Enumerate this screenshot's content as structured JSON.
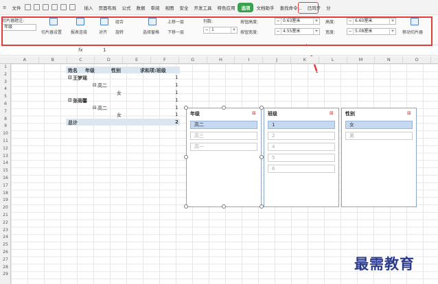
{
  "menubar": {
    "hamburger": "≡",
    "file": "文件",
    "tabs": [
      "插入",
      "页面布局",
      "公式",
      "数据",
      "审阅",
      "视图",
      "安全",
      "开发工具",
      "特色应用"
    ],
    "active_tab": "选项",
    "tabs_right": [
      "文档助手"
    ],
    "search": "查找命令...",
    "sync": "已同步",
    "share": "分"
  },
  "ribbon": {
    "slicer_title_label": "切片器题注:",
    "slicer_title_value": "年级",
    "slicer_settings": "切片器设置",
    "report_conn": "报表连接",
    "align": "对齐",
    "group": "组合",
    "rotate": "旋转",
    "selection_pane": "选择窗格",
    "bring_forward": "上移一层",
    "send_backward": "下移一层",
    "columns_label": "列数:",
    "columns_value": "1",
    "btn_height_label": "按钮高度:",
    "btn_height_value": "0.63厘米",
    "btn_width_label": "按钮宽度:",
    "btn_width_value": "4.55厘米",
    "height_label": "高度:",
    "height_value": "6.60厘米",
    "width_label": "宽度:",
    "width_value": "5.08厘米",
    "move_slicer": "移动切片器",
    "minus": "−",
    "plus": "+"
  },
  "formula": {
    "fx": "fx",
    "value": "1"
  },
  "columns": [
    "A",
    "B",
    "C",
    "D",
    "E",
    "F",
    "G",
    "H",
    "I",
    "J",
    "K",
    "L",
    "M",
    "N",
    "O"
  ],
  "rows": [
    "1",
    "2",
    "3",
    "4",
    "5",
    "6",
    "7",
    "8",
    "9",
    "10",
    "11",
    "12",
    "13",
    "14",
    "15",
    "16",
    "17",
    "18",
    "19",
    "20",
    "21",
    "22",
    "23",
    "24",
    "25",
    "26",
    "27",
    "28",
    "29"
  ],
  "pivot": {
    "h_name": "姓名",
    "h_grade": "年级",
    "h_gender": "性别",
    "h_sum": "求和项:班级",
    "r1_name": "王梦瑶",
    "r1_val": "1",
    "r2_grade": "高二",
    "r2_val": "1",
    "r3_gender": "女",
    "r3_val": "1",
    "r4_name": "张雨馨",
    "r4_val": "1",
    "r5_grade": "高二",
    "r5_val": "1",
    "r6_gender": "女",
    "r6_val": "1",
    "total": "总计",
    "total_val": "2",
    "expand": "⊟"
  },
  "slicers": [
    {
      "title": "年级",
      "items": [
        {
          "label": "高二",
          "selected": true
        },
        {
          "label": "高三",
          "selected": false
        },
        {
          "label": "高一",
          "selected": false
        }
      ]
    },
    {
      "title": "班级",
      "items": [
        {
          "label": "1",
          "selected": true
        },
        {
          "label": "2",
          "selected": false
        },
        {
          "label": "4",
          "selected": false
        },
        {
          "label": "5",
          "selected": false
        },
        {
          "label": "6",
          "selected": false
        }
      ]
    },
    {
      "title": "性别",
      "items": [
        {
          "label": "女",
          "selected": true
        },
        {
          "label": "男",
          "selected": false
        }
      ]
    }
  ],
  "watermark": "最需教育",
  "colors": {
    "highlight": "#e23b3b",
    "active_tab": "#3aa14e",
    "selected_item": "#c5d9f1",
    "watermark": "#2b3a8c"
  }
}
